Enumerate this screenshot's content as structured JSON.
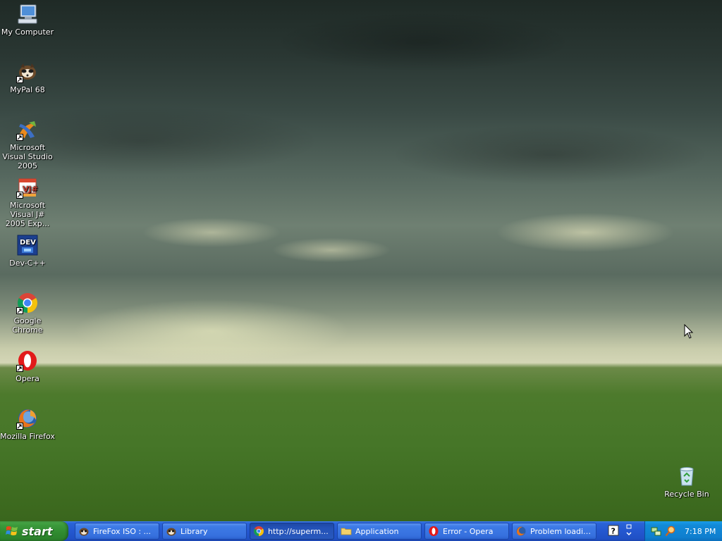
{
  "desktop": {
    "icons": [
      {
        "label": "My Computer",
        "icon": "computer-icon"
      },
      {
        "label": "MyPal 68",
        "icon": "mypal-icon"
      },
      {
        "label": "Microsoft Visual Studio 2005",
        "icon": "visual-studio-icon"
      },
      {
        "label": "Microsoft Visual J# 2005 Exp...",
        "icon": "visual-jsharp-icon"
      },
      {
        "label": "Dev-C++",
        "icon": "devcpp-icon"
      },
      {
        "label": "Google Chrome",
        "icon": "chrome-icon"
      },
      {
        "label": "Opera",
        "icon": "opera-icon"
      },
      {
        "label": "Mozilla Firefox",
        "icon": "firefox-icon"
      },
      {
        "label": "Recycle Bin",
        "icon": "recycle-bin-icon"
      }
    ]
  },
  "taskbar": {
    "start_label": "start",
    "tasks": [
      {
        "label": "FireFox ISO : ...",
        "icon": "mypal-icon",
        "active": false
      },
      {
        "label": "Library",
        "icon": "mypal-icon",
        "active": false
      },
      {
        "label": "http://superm...",
        "icon": "chrome-icon",
        "active": true
      },
      {
        "label": "Application",
        "icon": "folder-icon",
        "active": false
      },
      {
        "label": "Error - Opera",
        "icon": "opera-icon",
        "active": false
      },
      {
        "label": "Problem loadin...",
        "icon": "firefox-icon",
        "active": false
      }
    ],
    "clock": "7:18 PM"
  },
  "colors": {
    "taskbar_blue": "#2457d0",
    "start_green": "#3b9a3b",
    "tray_blue": "#128ad8"
  }
}
